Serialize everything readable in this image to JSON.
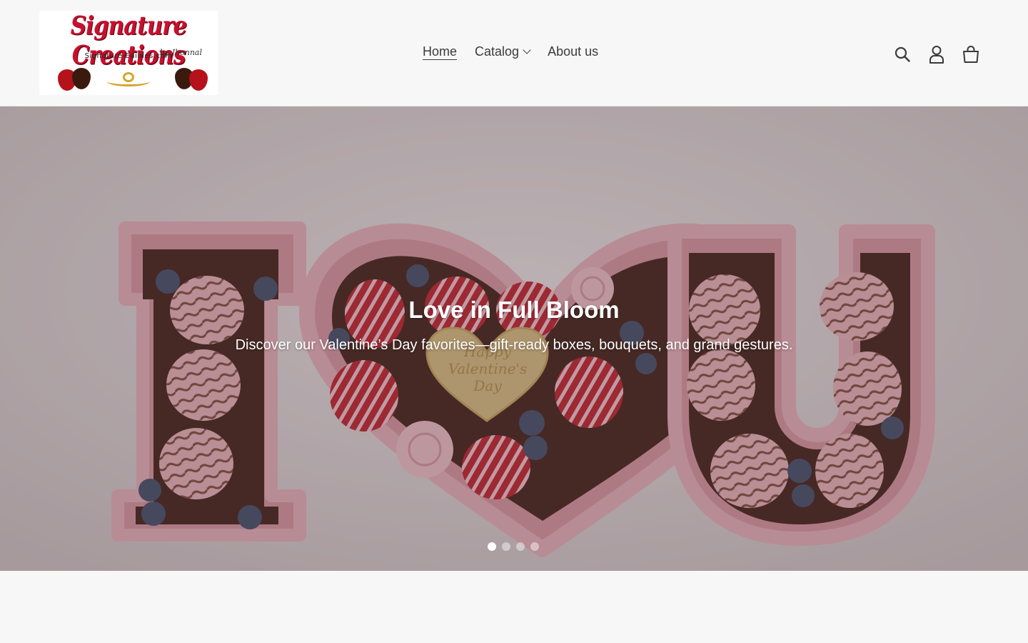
{
  "header": {
    "logo": {
      "title": "Signature Creations",
      "byline": "by Jhonnal",
      "url_text": "Signature-Edibles.com"
    },
    "nav": [
      {
        "label": "Home",
        "active": true
      },
      {
        "label": "Catalog",
        "has_dropdown": true
      },
      {
        "label": "About us"
      }
    ],
    "icons": [
      "search-icon",
      "account-icon",
      "cart-icon"
    ]
  },
  "hero": {
    "title": "Love in Full Bloom",
    "subtitle": "Discover our Valentine’s Day favorites—gift-ready boxes, bouquets, and grand gestures.",
    "image_text": "Happy Valentine's Day",
    "slides_total": 4,
    "active_slide": 1
  },
  "colors": {
    "page_bg": "#f7f7f7",
    "text": "#3a3a3a",
    "box_pink": "#d99aa6",
    "strawberry_red": "#c22a35"
  }
}
